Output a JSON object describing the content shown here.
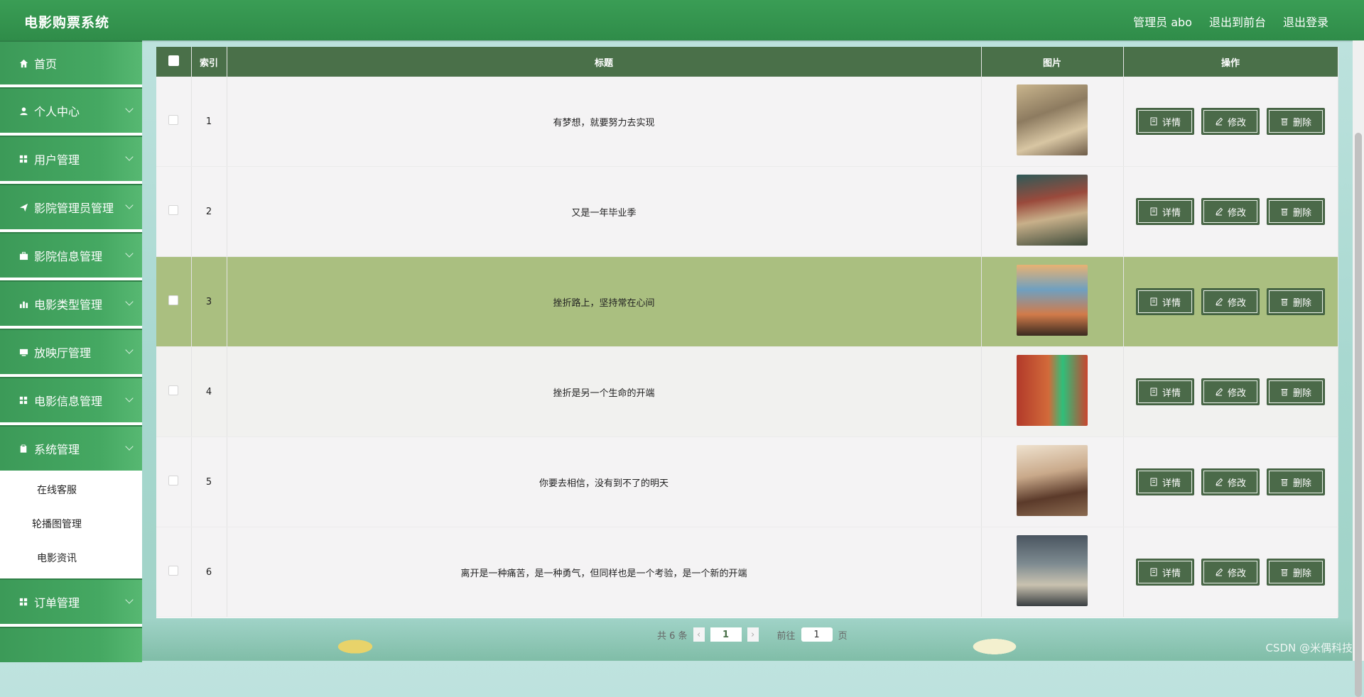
{
  "header": {
    "app_title": "电影购票系统",
    "admin_label": "管理员 abo",
    "to_frontend": "退出到前台",
    "logout": "退出登录"
  },
  "sidebar": {
    "items": [
      {
        "label": "首页",
        "icon": "home-icon"
      },
      {
        "label": "个人中心",
        "icon": "user-icon"
      },
      {
        "label": "用户管理",
        "icon": "grid-icon"
      },
      {
        "label": "影院管理员管理",
        "icon": "send-icon"
      },
      {
        "label": "影院信息管理",
        "icon": "briefcase-icon"
      },
      {
        "label": "电影类型管理",
        "icon": "bar-chart-icon"
      },
      {
        "label": "放映厅管理",
        "icon": "monitor-icon"
      },
      {
        "label": "电影信息管理",
        "icon": "grid-icon"
      },
      {
        "label": "系统管理",
        "icon": "clipboard-icon"
      }
    ],
    "submenu": [
      "在线客服",
      "轮播图管理",
      "电影资讯"
    ],
    "last_item": {
      "label": "订单管理",
      "icon": "grid-icon"
    }
  },
  "table": {
    "headers": {
      "index": "索引",
      "title": "标题",
      "image": "图片",
      "actions": "操作"
    },
    "rows": [
      {
        "index": "1",
        "title": "有梦想，就要努力去实现"
      },
      {
        "index": "2",
        "title": "又是一年毕业季"
      },
      {
        "index": "3",
        "title": "挫折路上，坚持常在心间"
      },
      {
        "index": "4",
        "title": "挫折是另一个生命的开端"
      },
      {
        "index": "5",
        "title": "你要去相信，没有到不了的明天"
      },
      {
        "index": "6",
        "title": "离开是一种痛苦，是一种勇气，但同样也是一个考验，是一个新的开端"
      }
    ],
    "buttons": {
      "detail": "详情",
      "edit": "修改",
      "delete": "删除"
    }
  },
  "pagination": {
    "total": "共 6 条",
    "current_page": "1",
    "goto_label": "前往",
    "goto_value": "1",
    "page_suffix": "页"
  },
  "watermark": "CSDN @米偶科技",
  "colors": {
    "header_green": "#3a9d55",
    "table_header": "#4a7049",
    "button": "#4b6a49",
    "highlight_row": "#aabf80"
  }
}
